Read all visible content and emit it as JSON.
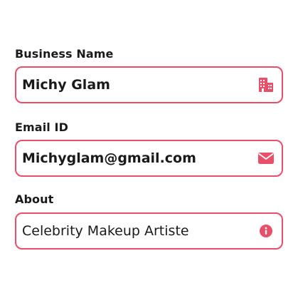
{
  "accent_color": "#e8506a",
  "fields": [
    {
      "label": "Business Name",
      "value": "Michy Glam",
      "icon": "building-icon"
    },
    {
      "label": "Email ID",
      "value": "Michyglam@gmail.com",
      "icon": "envelope-icon"
    },
    {
      "label": "About",
      "value": "Celebrity Makeup Artiste",
      "icon": "info-icon"
    }
  ]
}
